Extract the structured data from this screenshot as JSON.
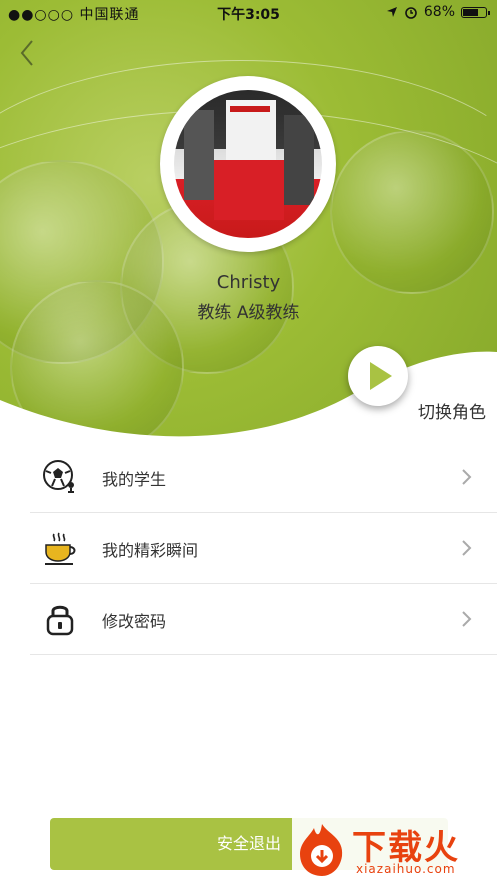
{
  "status_bar": {
    "carrier": "●●○○○ 中国联通",
    "time": "下午3:05",
    "battery": "68%",
    "battery_level": 0.68
  },
  "profile": {
    "name": "Christy",
    "role": "教练 A级教练"
  },
  "switch_role": {
    "label": "切换角色"
  },
  "menu": [
    {
      "label": "我的学生",
      "icon": "soccer-coach-icon"
    },
    {
      "label": "我的精彩瞬间",
      "icon": "coffee-cup-icon"
    },
    {
      "label": "修改密码",
      "icon": "lock-icon"
    }
  ],
  "logout": {
    "label": "安全退出"
  },
  "watermark": {
    "title": "下载火",
    "url": "xiazaihuo.com"
  },
  "colors": {
    "accent": "#a9c243",
    "hero_green": "#9cbc35",
    "watermark": "#e8420f"
  }
}
